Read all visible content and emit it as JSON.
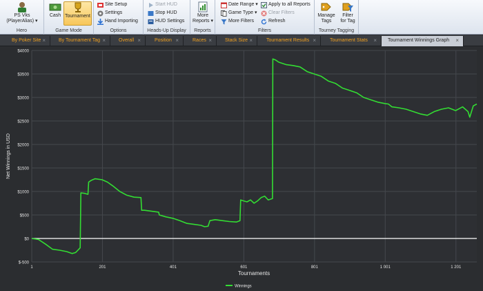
{
  "ribbon": {
    "hero": {
      "button_label": "PS Vks\n(PlayerAlias) ▾",
      "line1": "PS Vks",
      "line2": "(PlayerAlias) ▾",
      "group_label": "Hero"
    },
    "game_mode": {
      "cash": "Cash",
      "tournament": "Tournament",
      "group_label": "Game Mode"
    },
    "options": {
      "site_setup": "Site Setup",
      "settings": "Settings",
      "hand_importing": "Hand Importing",
      "group_label": "Options"
    },
    "hud": {
      "start": "Start HUD",
      "stop": "Stop HUD",
      "settings": "HUD Settings",
      "group_label": "Heads-Up Display"
    },
    "reports": {
      "more1": "More",
      "more2": "Reports ▾",
      "group_label": "Reports"
    },
    "filters": {
      "date_range": "Date Range ▾",
      "game_type": "Game Type ▾",
      "more_filters": "More Filters",
      "apply_all": "Apply to all Reports",
      "clear": "Clear Filters",
      "refresh": "Refresh",
      "group_label": "Filters"
    },
    "tagging": {
      "manage1": "Manage",
      "manage2": "Tags",
      "filter1": "Filter",
      "filter2": "for Tag",
      "group_label": "Tourney Tagging"
    }
  },
  "tabs": [
    {
      "label": "By Poker Site",
      "active": false
    },
    {
      "label": "By Tournament Tag",
      "active": false
    },
    {
      "label": "Overall",
      "active": false
    },
    {
      "label": "Position",
      "active": false
    },
    {
      "label": "Races",
      "active": false
    },
    {
      "label": "Stack Size",
      "active": false
    },
    {
      "label": "Tournament Results",
      "active": false
    },
    {
      "label": "Tournament Stats",
      "active": false
    },
    {
      "label": "Tournament Winnings Graph",
      "active": true
    }
  ],
  "colors": {
    "series": "#33dd33",
    "zero_line": "#ffffff",
    "plot_bg": "#2d2f33",
    "grid": "#45484d",
    "tab_text": "#f0a020"
  },
  "chart_data": {
    "type": "line",
    "title": "",
    "xlabel": "Tournaments",
    "ylabel": "Net Winnings in USD",
    "xlim": [
      1,
      1260
    ],
    "ylim": [
      -500,
      4000
    ],
    "x_ticks": [
      1,
      201,
      401,
      601,
      801,
      1001,
      1201
    ],
    "x_tick_labels": [
      "1",
      "201",
      "401",
      "601",
      "801",
      "1 001",
      "1 201"
    ],
    "y_ticks": [
      -500,
      0,
      500,
      1000,
      1500,
      2000,
      2500,
      3000,
      3500,
      4000
    ],
    "y_tick_labels": [
      "$-500",
      "$0",
      "$500",
      "$1000",
      "$1500",
      "$2000",
      "$2500",
      "$3000",
      "$3500",
      "$4000"
    ],
    "grid": true,
    "legend": "bottom-center",
    "series": [
      {
        "name": "Winnings",
        "x": [
          1,
          20,
          40,
          60,
          80,
          100,
          115,
          125,
          138,
          140,
          150,
          160,
          162,
          170,
          180,
          190,
          200,
          215,
          230,
          250,
          270,
          290,
          310,
          312,
          320,
          340,
          360,
          362,
          380,
          400,
          420,
          440,
          460,
          480,
          490,
          500,
          505,
          520,
          540,
          560,
          580,
          590,
          592,
          600,
          610,
          620,
          630,
          640,
          650,
          660,
          670,
          682,
          683,
          690,
          700,
          720,
          740,
          760,
          780,
          800,
          820,
          840,
          860,
          880,
          900,
          920,
          940,
          960,
          980,
          1000,
          1010,
          1020,
          1040,
          1060,
          1080,
          1100,
          1120,
          1140,
          1160,
          1180,
          1200,
          1220,
          1235,
          1240,
          1250,
          1260
        ],
        "values": [
          0,
          -20,
          -120,
          -230,
          -250,
          -280,
          -320,
          -300,
          -200,
          970,
          960,
          940,
          1200,
          1240,
          1270,
          1260,
          1250,
          1200,
          1120,
          1000,
          920,
          880,
          870,
          600,
          600,
          580,
          560,
          500,
          460,
          430,
          380,
          320,
          300,
          280,
          250,
          260,
          380,
          400,
          380,
          360,
          350,
          380,
          820,
          800,
          780,
          820,
          750,
          800,
          870,
          900,
          820,
          850,
          3820,
          3800,
          3750,
          3700,
          3680,
          3650,
          3550,
          3500,
          3450,
          3350,
          3300,
          3200,
          3150,
          3100,
          3000,
          2950,
          2900,
          2870,
          2860,
          2800,
          2780,
          2750,
          2700,
          2650,
          2620,
          2700,
          2750,
          2780,
          2720,
          2800,
          2700,
          2580,
          2820,
          2860
        ]
      }
    ]
  }
}
